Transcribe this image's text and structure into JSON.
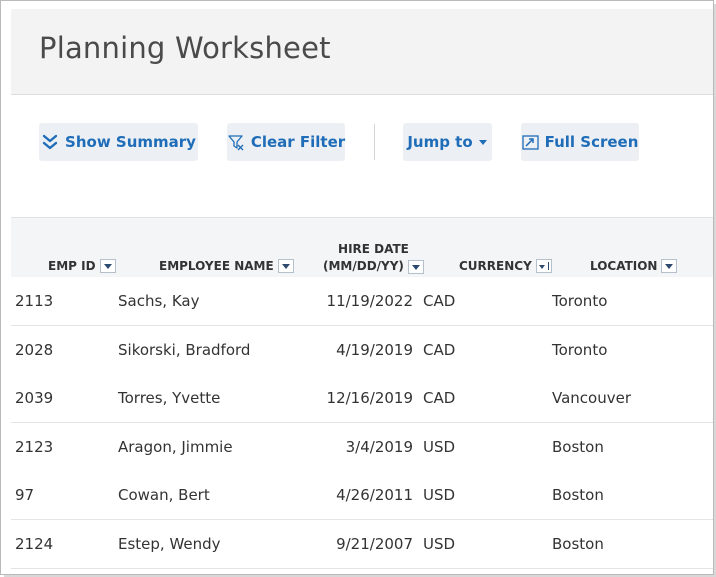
{
  "page": {
    "title": "Planning Worksheet"
  },
  "toolbar": {
    "show_summary": {
      "label": "Show Summary",
      "icon": "double-chevron-down-icon"
    },
    "clear_filter": {
      "label": "Clear Filter",
      "icon": "filter-clear-icon"
    },
    "jump_to": {
      "label": "Jump to",
      "icon": "caret-down-icon"
    },
    "full_screen": {
      "label": "Full Screen",
      "icon": "expand-icon"
    }
  },
  "table": {
    "columns": [
      {
        "label": "EMP ID"
      },
      {
        "label": "EMPLOYEE NAME"
      },
      {
        "label_line1": "HIRE DATE",
        "label_line2": "(MM/DD/YY)"
      },
      {
        "label": "CURRENCY"
      },
      {
        "label": "LOCATION"
      }
    ],
    "rows": [
      {
        "emp_id": "2113",
        "name": "Sachs, Kay",
        "hire_date": "11/19/2022",
        "currency": "CAD",
        "location": "Toronto"
      },
      {
        "emp_id": "2028",
        "name": "Sikorski, Bradford",
        "hire_date": "4/19/2019",
        "currency": "CAD",
        "location": "Toronto"
      },
      {
        "emp_id": "2039",
        "name": "Torres, Yvette",
        "hire_date": "12/16/2019",
        "currency": "CAD",
        "location": "Vancouver"
      },
      {
        "emp_id": "2123",
        "name": "Aragon, Jimmie",
        "hire_date": "3/4/2019",
        "currency": "USD",
        "location": "Boston"
      },
      {
        "emp_id": "97",
        "name": "Cowan, Bert",
        "hire_date": "4/26/2011",
        "currency": "USD",
        "location": "Boston"
      },
      {
        "emp_id": "2124",
        "name": "Estep, Wendy",
        "hire_date": "9/21/2007",
        "currency": "USD",
        "location": "Boston"
      }
    ]
  },
  "colors": {
    "accent": "#1f6db8",
    "button_bg": "#ecf0f4",
    "header_bg": "#f3f3f3"
  }
}
